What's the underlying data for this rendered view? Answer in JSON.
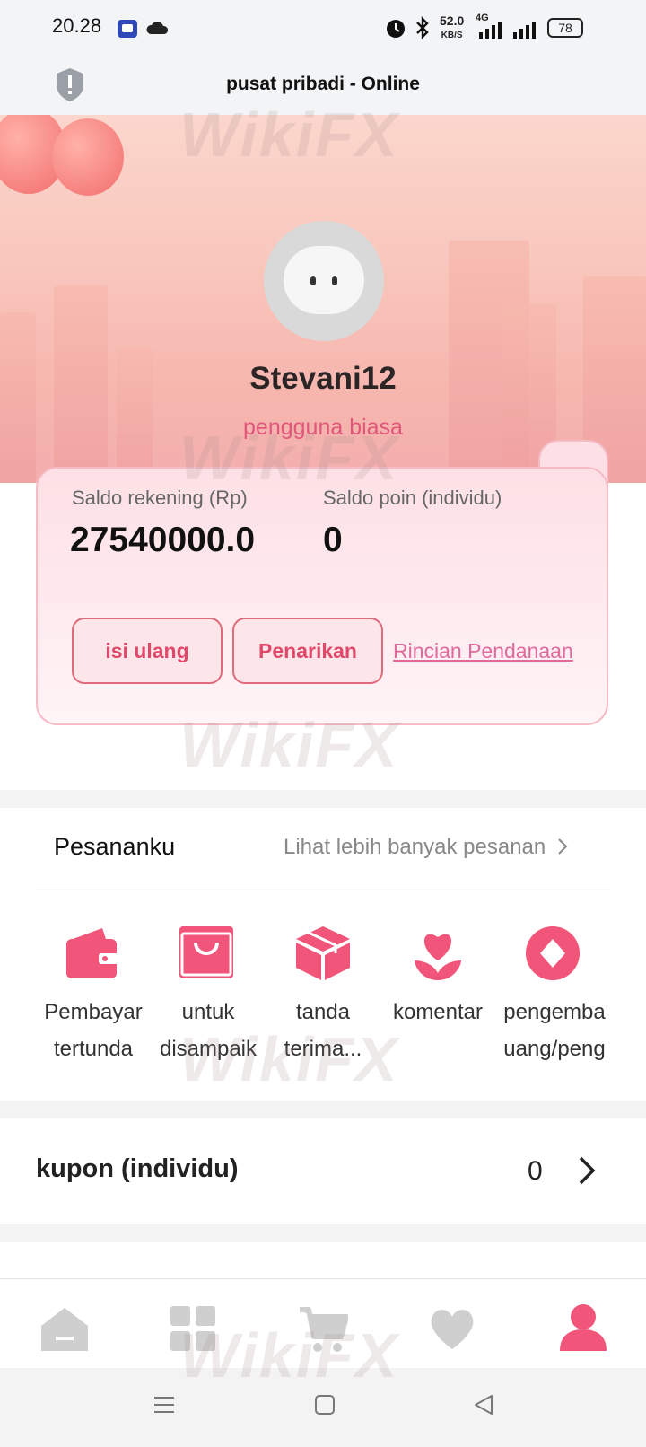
{
  "status_bar": {
    "time": "20.28",
    "net_speed": "52.0",
    "net_unit": "KB/S",
    "network": "4G",
    "battery": "78"
  },
  "header": {
    "title": "pusat pribadi - Online"
  },
  "profile": {
    "username": "Stevani12",
    "user_type": "pengguna biasa"
  },
  "balance_card": {
    "account_label": "Saldo rekening (Rp)",
    "account_value": "27540000.0",
    "points_label": "Saldo poin (individu)",
    "points_value": "0",
    "topup_label": "isi ulang",
    "withdraw_label": "Penarikan",
    "funding_link": "Rincian Pendanaan"
  },
  "orders": {
    "title": "Pesananku",
    "more_label": "Lihat lebih banyak pesanan",
    "items": [
      {
        "line1": "Pembayar",
        "line2": "tertunda",
        "icon": "wallet-icon"
      },
      {
        "line1": "untuk",
        "line2": "disampaik",
        "icon": "shopping-bag-icon"
      },
      {
        "line1": "tanda",
        "line2": "terima...",
        "icon": "package-icon"
      },
      {
        "line1": "komentar",
        "line2": "",
        "icon": "heart-flower-icon"
      },
      {
        "line1": "pengemba",
        "line2": "uang/peng",
        "icon": "refund-icon"
      }
    ]
  },
  "coupon": {
    "label": "kupon (individu)",
    "count": "0"
  },
  "tabbar": {
    "items": [
      "home-icon",
      "grid-icon",
      "cart-icon",
      "heart-icon",
      "user-icon"
    ],
    "active_color": "#f2557a",
    "inactive_color": "#cfcfcf"
  },
  "watermark": "WikiFX",
  "accent_color": "#f2557a"
}
